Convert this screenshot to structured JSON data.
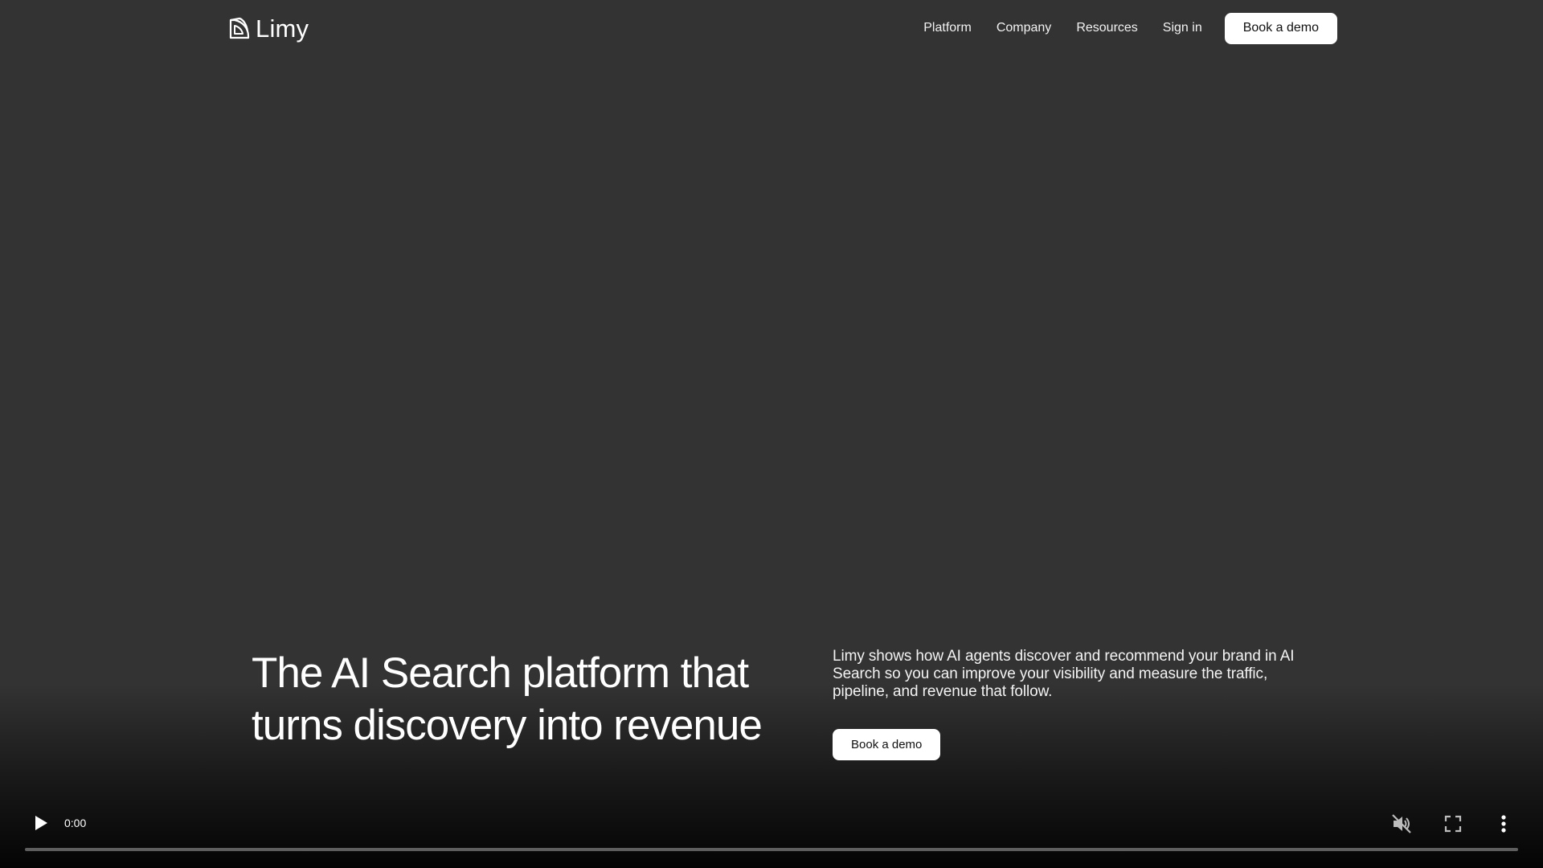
{
  "brand": {
    "name": "Limy"
  },
  "nav": {
    "items": [
      {
        "label": "Platform"
      },
      {
        "label": "Company"
      },
      {
        "label": "Resources"
      },
      {
        "label": "Sign in"
      }
    ],
    "cta_label": "Book a demo"
  },
  "hero": {
    "title_line1": "The AI Search platform that",
    "title_line2": "turns discovery into revenue",
    "description": "Limy shows how AI agents discover and recommend your brand in AI Search so you can improve your visibility and measure the traffic, pipeline, and revenue that follow.",
    "cta_label": "Book a demo"
  },
  "video": {
    "current_time": "0:00",
    "progress": 0,
    "muted": true
  },
  "colors": {
    "background": "#333333",
    "text": "#ffffff",
    "button_bg": "#ffffff",
    "button_text": "#111111"
  },
  "icons": {
    "logo": "limy-logo-icon",
    "play": "play-icon",
    "mute": "volume-muted-icon",
    "fullscreen": "fullscreen-icon",
    "more": "more-vertical-icon"
  }
}
